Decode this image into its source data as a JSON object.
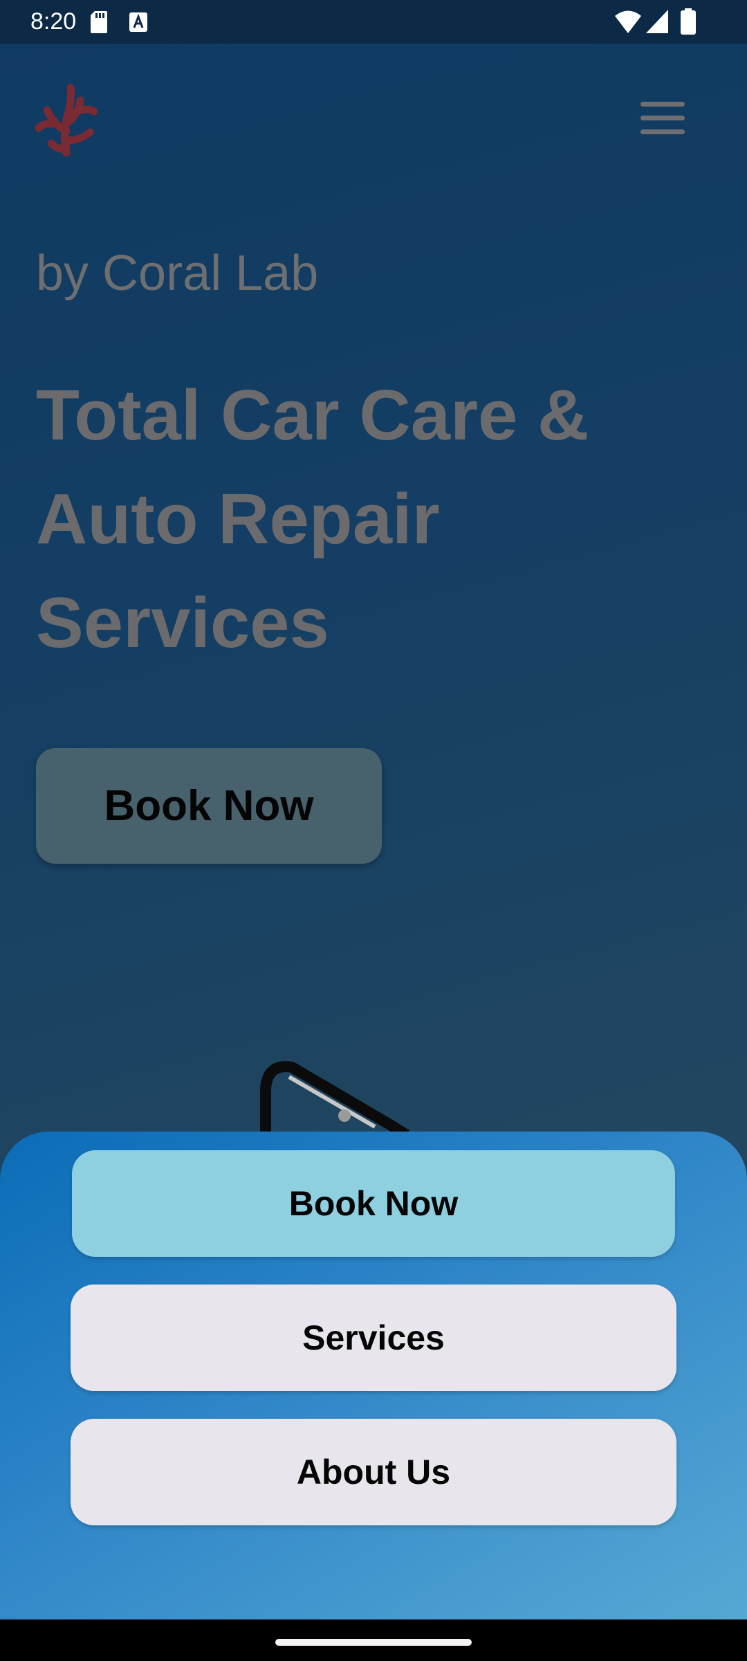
{
  "status_bar": {
    "time": "8:20",
    "icons": [
      "sd-card-icon",
      "a-notification-icon",
      "wifi-icon",
      "signal-icon",
      "battery-icon"
    ]
  },
  "header": {
    "logo_icon": "coral-logo-icon",
    "menu_icon": "hamburger-menu-icon"
  },
  "hero": {
    "subtitle": "by Coral Lab",
    "title": "Total Car Care &\n Auto Repair\n Services",
    "book_button": "Book Now"
  },
  "bottom_sheet": {
    "buttons": [
      {
        "label": "Book Now"
      },
      {
        "label": "Services"
      },
      {
        "label": "About Us"
      }
    ]
  },
  "colors": {
    "background": "#153f63",
    "logo": "#7a2a33",
    "sheet_primary": "#8ecfe0",
    "sheet_secondary": "#e8e6ec",
    "hero_button": "#48626d"
  }
}
